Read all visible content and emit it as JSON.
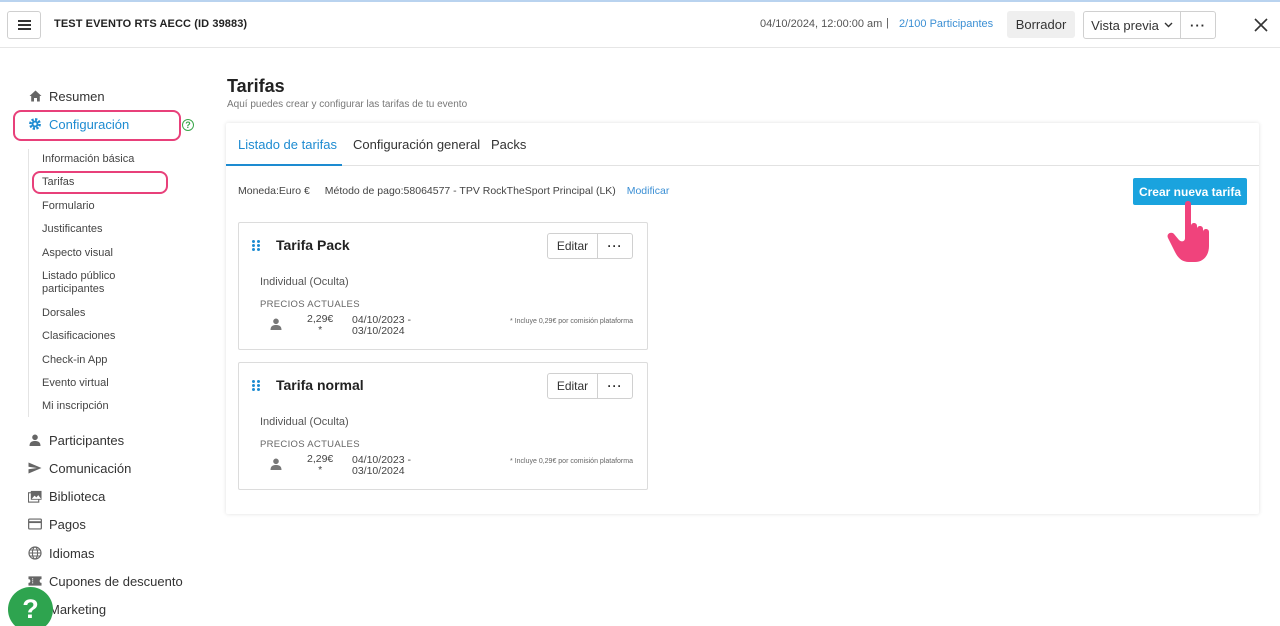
{
  "header": {
    "event_title": "TEST EVENTO RTS AECC (ID 39883)",
    "date": "04/10/2024, 12:00:00 am",
    "separator": "|",
    "participants": "2/100 Participantes",
    "draft_label": "Borrador",
    "preview_label": "Vista previa",
    "more_label": "···"
  },
  "sidebar": {
    "items_top": [
      {
        "label": "Resumen",
        "icon": "home-icon"
      },
      {
        "label": "Configuración",
        "icon": "gear-icon"
      }
    ],
    "config_subitems": [
      "Información básica",
      "Tarifas",
      "Formulario",
      "Justificantes",
      "Aspecto visual",
      "Listado público participantes",
      "Dorsales",
      "Clasificaciones",
      "Check-in App",
      "Evento virtual",
      "Mi inscripción"
    ],
    "items_bottom": [
      {
        "label": "Participantes",
        "icon": "person-icon"
      },
      {
        "label": "Comunicación",
        "icon": "send-icon"
      },
      {
        "label": "Biblioteca",
        "icon": "images-icon"
      },
      {
        "label": "Pagos",
        "icon": "credit-card-icon"
      },
      {
        "label": "Idiomas",
        "icon": "globe-icon"
      },
      {
        "label": "Cupones de descuento",
        "icon": "coupon-icon"
      },
      {
        "label": "Marketing",
        "icon": "megaphone-icon"
      }
    ],
    "help_badge": "?",
    "help_fab": "?"
  },
  "main": {
    "title": "Tarifas",
    "subtitle": "Aquí puedes crear y configurar las tarifas de tu evento",
    "tabs": [
      "Listado de tarifas",
      "Configuración general",
      "Packs"
    ],
    "meta": {
      "currency_label": "Moneda:",
      "currency_value": "Euro €",
      "payment_label": "Método de pago:",
      "payment_value": "58064577 - TPV RockTheSport Principal (LK)",
      "modify_link": "Modificar"
    },
    "create_button": "Crear nueva tarifa",
    "cards": [
      {
        "name": "Tarifa Pack",
        "edit_label": "Editar",
        "more_label": "···",
        "type": "Individual (Oculta)",
        "prices_label": "PRECIOS ACTUALES",
        "price_value": "2,29€",
        "price_mark": "*",
        "date_from": "04/10/2023 -",
        "date_to": "03/10/2024",
        "note": "* Incluye 0,29€ por comisión plataforma"
      },
      {
        "name": "Tarifa normal",
        "edit_label": "Editar",
        "more_label": "···",
        "type": "Individual (Oculta)",
        "prices_label": "PRECIOS ACTUALES",
        "price_value": "2,29€",
        "price_mark": "*",
        "date_from": "04/10/2023 -",
        "date_to": "03/10/2024",
        "note": "* Incluye 0,29€ por comisión plataforma"
      }
    ]
  },
  "colors": {
    "accent": "#1d8bd1",
    "create_button": "#1aa3de",
    "highlight": "#e8407a",
    "help_green": "#2ea44f"
  }
}
